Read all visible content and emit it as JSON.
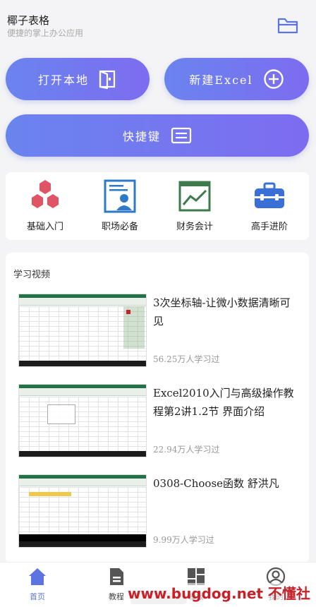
{
  "header": {
    "title": "椰子表格",
    "subtitle": "便捷的掌上办公应用",
    "folder_icon": "folder-icon"
  },
  "actions": {
    "open_local": "打开本地",
    "new_excel": "新建Excel",
    "shortcut": "快捷键"
  },
  "categories": [
    {
      "label": "基础入门",
      "icon": "hexagons-icon"
    },
    {
      "label": "职场必备",
      "icon": "profile-card-icon"
    },
    {
      "label": "财务会计",
      "icon": "chart-board-icon"
    },
    {
      "label": "高手进阶",
      "icon": "toolbox-icon"
    }
  ],
  "videos": {
    "section_title": "学习视频",
    "items": [
      {
        "title": "3次坐标轴-让微小数据清晰可见",
        "count": "56.25万人学习过"
      },
      {
        "title": "Excel2010入门与高级操作教程第2讲1.2节 界面介绍",
        "count": "22.94万人学习过"
      },
      {
        "title": "0308-Choose函数 舒洪凡",
        "count": "9.99万人学习过"
      }
    ]
  },
  "bottom_nav": {
    "tabs": [
      {
        "label": "首页",
        "icon": "home-icon",
        "active": true
      },
      {
        "label": "教程",
        "icon": "document-icon",
        "active": false
      },
      {
        "label": "模板",
        "icon": "grid-icon",
        "active": false
      },
      {
        "label": "我的",
        "icon": "user-icon",
        "active": false
      }
    ]
  },
  "watermark": "www.bugdog.net 不懂社区",
  "colors": {
    "accent_start": "#6a84ee",
    "accent_end": "#7d6cf0",
    "hex_red": "#e05566",
    "blue": "#2e78c8",
    "green": "#3f7a4e",
    "toolbox_blue": "#3a6fd8",
    "nav_active": "#5b74e0"
  }
}
